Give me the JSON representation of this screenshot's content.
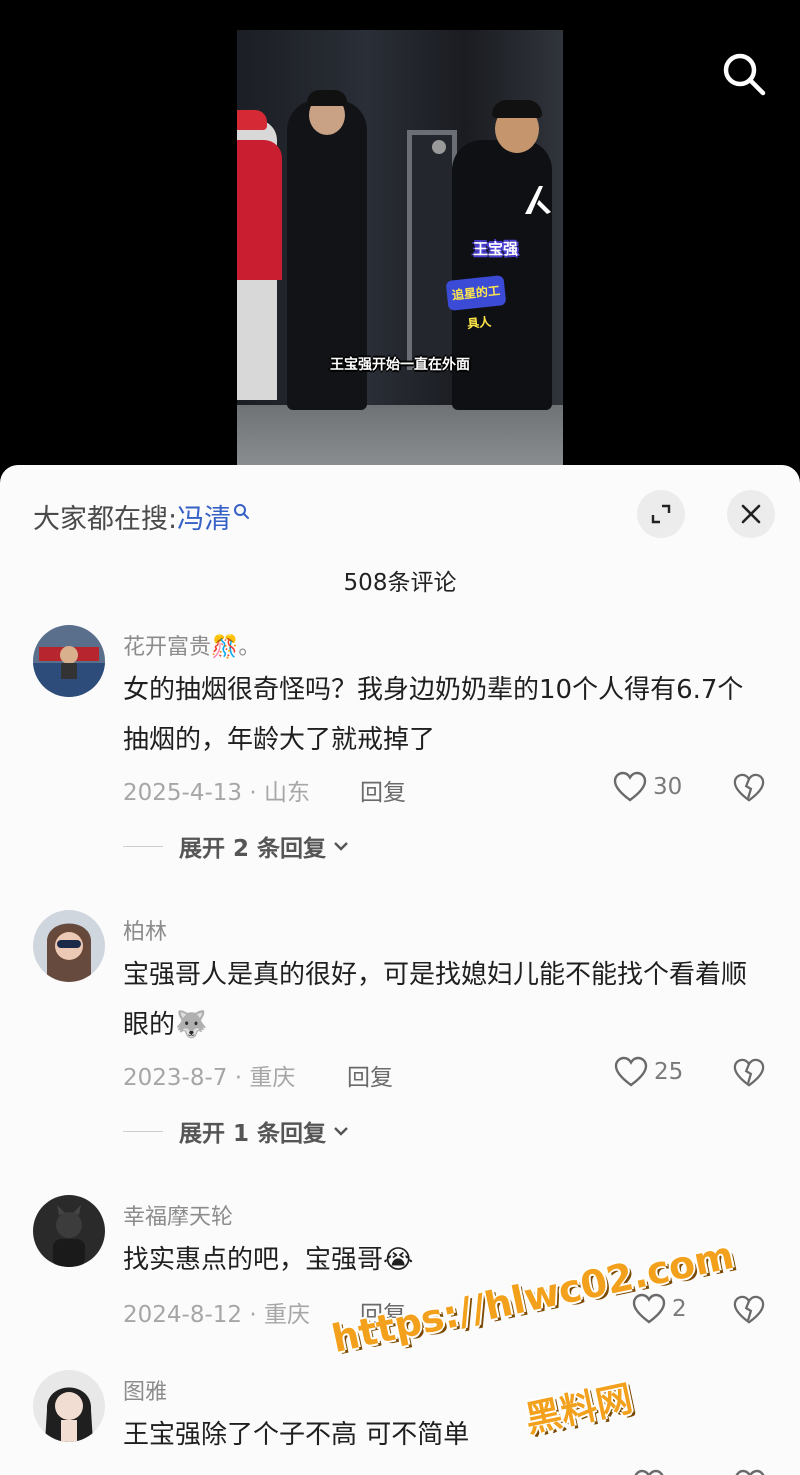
{
  "video": {
    "tag_name": "王宝强",
    "tag_badge": "追星的工具人",
    "subtitle": "王宝强开始一直在外面"
  },
  "header": {
    "search_prefix": "大家都在搜:",
    "search_keyword": "冯清",
    "comment_count": "508条评论"
  },
  "comments": [
    {
      "user": "花开富贵🎊。",
      "text": "女的抽烟很奇怪吗？我身边奶奶辈的10个人得有6.7个抽烟的，年龄大了就戒掉了",
      "meta": "2025-4-13 · 山东",
      "reply": "回复",
      "likes": "30",
      "expand": "展开 2 条回复"
    },
    {
      "user": "柏林",
      "text": "宝强哥人是真的很好，可是找媳妇儿能不能找个看着顺眼的🐺",
      "meta": "2023-8-7 · 重庆",
      "reply": "回复",
      "likes": "25",
      "expand": "展开 1 条回复"
    },
    {
      "user": "幸福摩天轮",
      "text": "找实惠点的吧，宝强哥😭",
      "meta": "2024-8-12 · 重庆",
      "reply": "回复",
      "likes": "2"
    },
    {
      "user": "图雅",
      "text": "王宝强除了个子不高 可不简单"
    }
  ],
  "watermark": {
    "url": "https://hlwc02.com",
    "name": "黑料网"
  }
}
